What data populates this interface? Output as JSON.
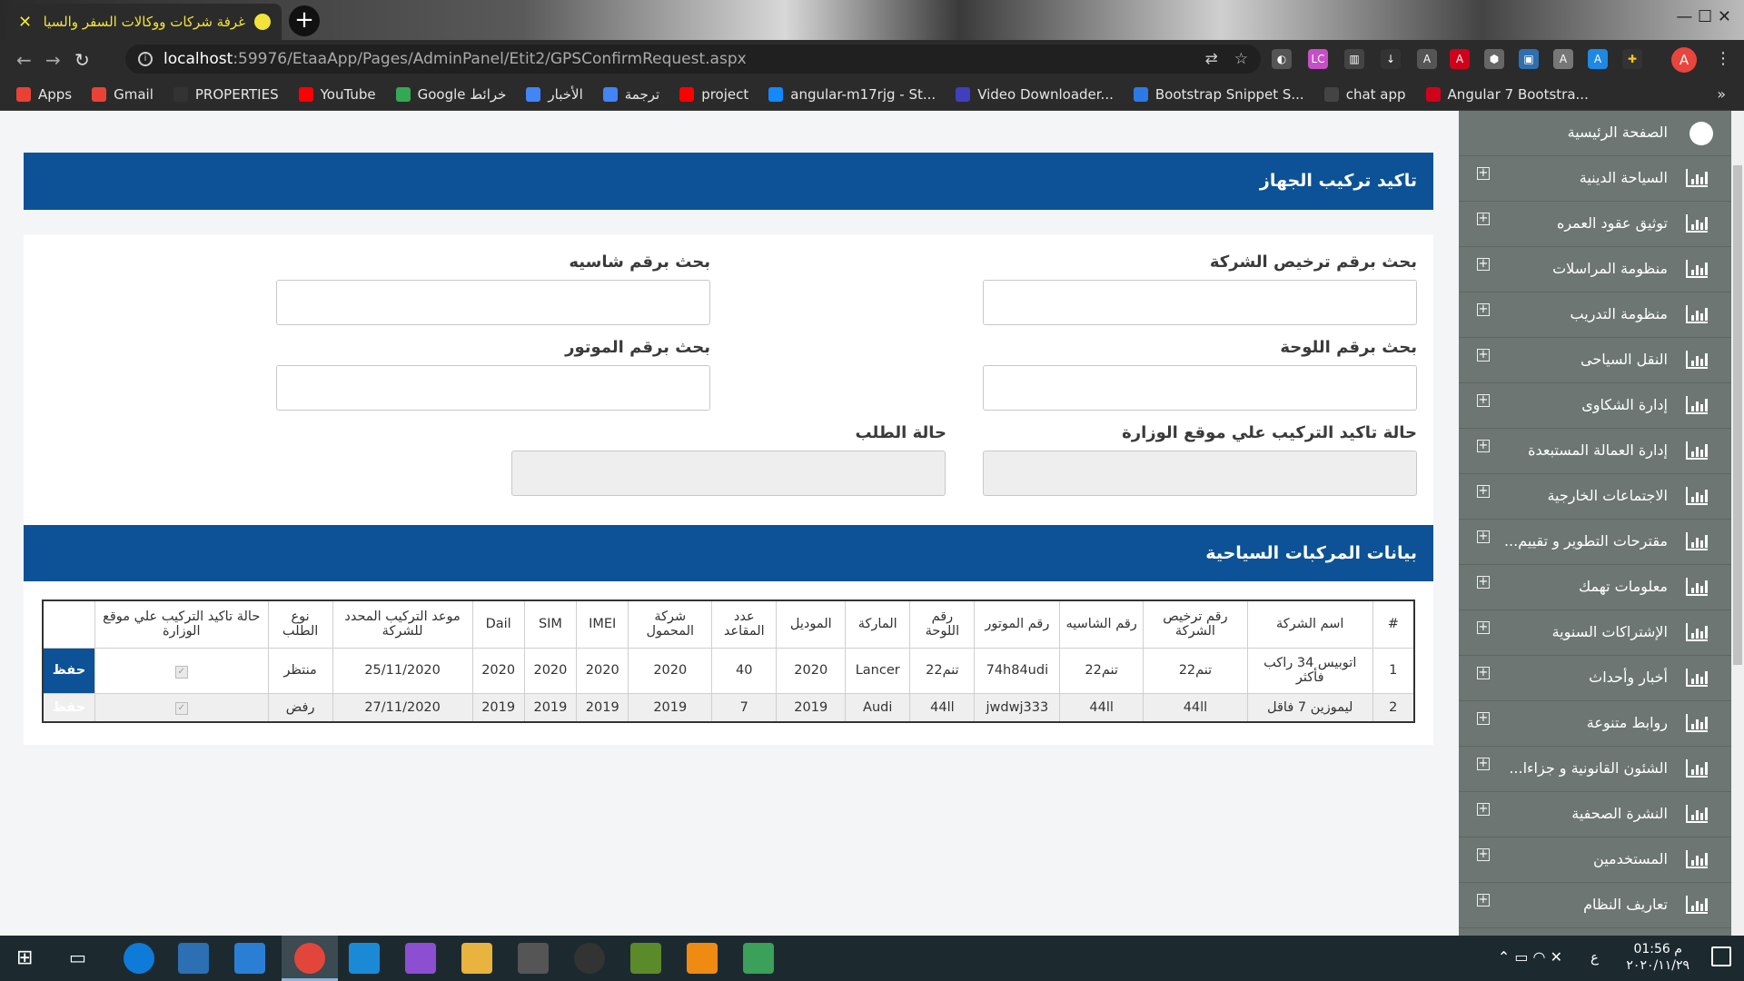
{
  "browser": {
    "tab_title": "غرفة شركات ووكالات السفر والسيا",
    "tab_close": "✕",
    "new_tab": "+",
    "url_host": "localhost",
    "url_path": ":59976/EtaaApp/Pages/AdminPanel/Etit2/GPSConfirmRequest.aspx",
    "profile_initial": "A",
    "bookmarks": [
      {
        "label": "Apps",
        "color": "#e94235"
      },
      {
        "label": "Gmail",
        "color": "#ea4335"
      },
      {
        "label": "PROPERTIES",
        "color": "#333333"
      },
      {
        "label": "YouTube",
        "color": "#ff0000"
      },
      {
        "label": "Google خرائط",
        "color": "#34a853"
      },
      {
        "label": "الأخبار",
        "color": "#4285f4"
      },
      {
        "label": "ترجمة",
        "color": "#4285f4"
      },
      {
        "label": "project",
        "color": "#ff0000"
      },
      {
        "label": "angular-m17rjg - St...",
        "color": "#1389fd"
      },
      {
        "label": "Video Downloader...",
        "color": "#3f3fbf"
      },
      {
        "label": "Bootstrap Snippet S...",
        "color": "#2c7be5"
      },
      {
        "label": "chat app",
        "color": "#444444"
      },
      {
        "label": "Angular 7 Bootstra...",
        "color": "#d0021b"
      }
    ],
    "bookmarks_more": "»"
  },
  "page": {
    "header_title": "تاكيد تركيب الجهاز",
    "form": {
      "license_label": "بحث برقم ترخيص الشركة",
      "chassis_label": "بحث برقم شاسيه",
      "plate_label": "بحث برقم اللوحة",
      "motor_label": "بحث برقم الموتور",
      "ministry_status_label": "حالة تاكيد التركيب علي موقع الوزارة",
      "request_status_label": "حالة الطلب"
    },
    "table_header_title": "بيانات المركبات السياحية",
    "table": {
      "columns": [
        "#",
        "اسم الشركة",
        "رقم ترخيص الشركة",
        "رقم الشاسيه",
        "رقم الموتور",
        "رقم اللوحة",
        "الماركة",
        "الموديل",
        "عدد المقاعد",
        "شركة المحمول",
        "IMEI",
        "SIM",
        "Dail",
        "موعد التركيب المحدد للشركة",
        "نوع الطلب",
        "حالة تاكيد التركيب علي موقع الوزارة",
        ""
      ],
      "rows": [
        [
          "1",
          "اتوبيس 34 راكب فأكثر",
          "تنم22",
          "تنم22",
          "74h84udi",
          "تنم22",
          "Lancer",
          "2020",
          "40",
          "2020",
          "2020",
          "2020",
          "2020",
          "25/11/2020",
          "منتظر",
          "✓",
          "حفظ"
        ],
        [
          "2",
          "ليموزين 7 فاقل",
          "44ll",
          "44ll",
          "jwdwj333",
          "44ll",
          "Audi",
          "2019",
          "7",
          "2019",
          "2019",
          "2019",
          "2019",
          "27/11/2020",
          "رفض",
          "✓",
          "حفظ"
        ]
      ]
    }
  },
  "sidebar": {
    "items": [
      {
        "label": "الصفحة الرئيسية",
        "icon": "dashboard-icon"
      },
      {
        "label": "السياحة الدينية",
        "icon": "bar-chart-icon"
      },
      {
        "label": "توثيق عقود العمره",
        "icon": "bar-chart-icon"
      },
      {
        "label": "منظومة المراسلات",
        "icon": "bar-chart-icon"
      },
      {
        "label": "منظومة التدريب",
        "icon": "bar-chart-icon"
      },
      {
        "label": "النقل السياحى",
        "icon": "bar-chart-icon"
      },
      {
        "label": "إدارة الشكاوى",
        "icon": "bar-chart-icon"
      },
      {
        "label": "إدارة العمالة المستبعدة",
        "icon": "bar-chart-icon"
      },
      {
        "label": "الاجتماعات الخارجية",
        "icon": "bar-chart-icon"
      },
      {
        "label": "مقترحات التطوير و تقييم...",
        "icon": "bar-chart-icon"
      },
      {
        "label": "معلومات تهمك",
        "icon": "bar-chart-icon"
      },
      {
        "label": "الإشتراكات السنوية",
        "icon": "bar-chart-icon"
      },
      {
        "label": "أخبار وأحداث",
        "icon": "bar-chart-icon"
      },
      {
        "label": "روابط متنوعة",
        "icon": "bar-chart-icon"
      },
      {
        "label": "الشئون القانونية و جزاءا...",
        "icon": "bar-chart-icon"
      },
      {
        "label": "النشرة الصحفية",
        "icon": "bar-chart-icon"
      },
      {
        "label": "المستخدمين",
        "icon": "bar-chart-icon"
      },
      {
        "label": "تعاريف النظام",
        "icon": "bar-chart-icon"
      }
    ]
  },
  "taskbar": {
    "time": "01:56 م",
    "date": "٢٠٢٠/١١/٢٩",
    "lang": "ع"
  },
  "colors": {
    "header_blue": "#0d5296",
    "sidebar_gray": "#6d7672",
    "content_bg": "#f4f5f7"
  }
}
